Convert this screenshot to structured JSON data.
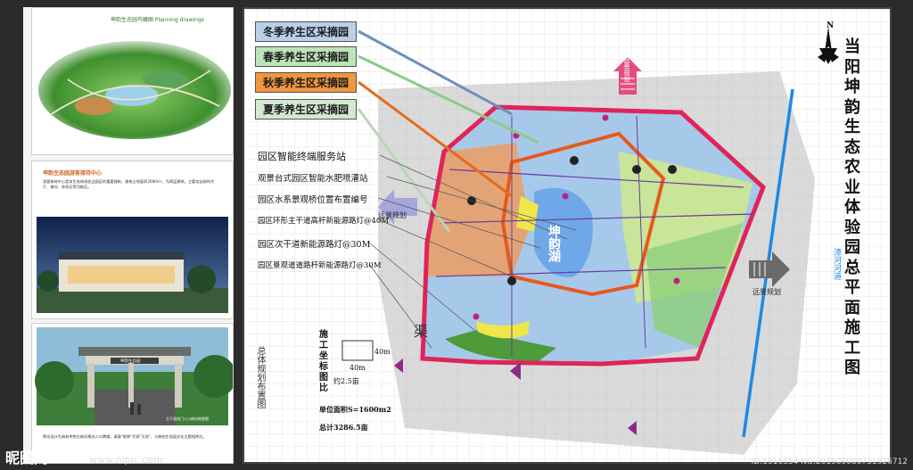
{
  "left": {
    "card1_title": "坤韵生态园鸟瞰图 Planning drawings",
    "card2_title": "坤韵生态园游客接待中心",
    "card2_text": "游客接待中心是本生态休闲农业园区的重要建筑，建筑占地面积2680m²，为两层建筑，主要包括接待大厅、餐饮、休息区等功能区。",
    "card3_gate_label": "坤韵生态园",
    "card3_caption": "主干道进门入口南坊效果图",
    "card3_text": "牌坊设计为具有传统古典风格的入口牌楼，寓意\"乾坤\"代表\"天地\"，与坤韵生态园文化主题相呼应。"
  },
  "legend": [
    {
      "label": "冬季养生区采摘园",
      "color": "#b9d0ea"
    },
    {
      "label": "春季养生区采摘园",
      "color": "#bde4b8"
    },
    {
      "label": "秋季养生区采摘园",
      "color": "#f1963e"
    },
    {
      "label": "夏季养生区采摘园",
      "color": "#d4e8d2"
    }
  ],
  "notes": [
    "园区智能终端服务站",
    "观景台式园区智能水肥喷灌站",
    "园区水系景观桥位置布置编号",
    "园区环形主干道高杆新能源路灯@40M",
    "园区次干道新能源路灯@30M",
    "园区景观道道路杆新能源路灯@30M"
  ],
  "title": "当阳坤韵生态农业体验园总平面施工图",
  "map_labels": {
    "lake": "坤韵湖",
    "river": "漳河河道",
    "ditch": "渠",
    "far_north": "远景规划",
    "far_west": "远景规划",
    "far_east": "远景规划",
    "north_mark": "N"
  },
  "scale": {
    "vertical_label": "施工坐标图比",
    "side_40": "40m",
    "bottom_40": "40m",
    "approx": "约2.5亩",
    "unit_area": "单位面积S=1600m2",
    "total": "总计3286.5亩",
    "layout_caption": "总体规划布置图"
  },
  "watermark": {
    "site": "昵图网",
    "url": "www.nipic.com",
    "id": "ID:1916554 NO:20190908073192671​2"
  }
}
